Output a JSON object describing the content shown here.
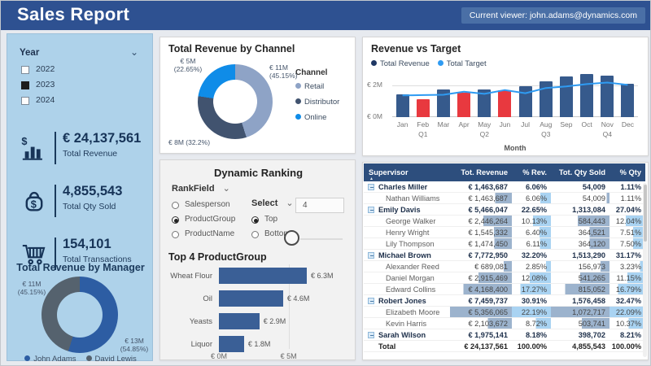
{
  "header": {
    "title": "Sales Report",
    "viewer_badge": "Current viewer: john.adams@dynamics.com"
  },
  "sidebar": {
    "year_filter": {
      "label": "Year",
      "options": [
        {
          "label": "2022",
          "checked": false
        },
        {
          "label": "2023",
          "checked": true
        },
        {
          "label": "2024",
          "checked": false
        }
      ]
    },
    "kpis": [
      {
        "icon": "revenue-chart-icon",
        "value": "€ 24,137,561",
        "label": "Total Revenue"
      },
      {
        "icon": "money-bag-icon",
        "value": "4,855,543",
        "label": "Total Qty Sold"
      },
      {
        "icon": "cart-icon",
        "value": "154,101",
        "label": "Total Transactions"
      }
    ],
    "manager_donut": {
      "title": "Total Revenue by Manager",
      "type": "donut",
      "slices": [
        {
          "name": "John Adams",
          "value": "€ 13M",
          "pct": 54.85,
          "color": "#2d5da3"
        },
        {
          "name": "David Lewis",
          "value": "€ 11M",
          "pct": 45.15,
          "color": "#55626e"
        }
      ],
      "labels": {
        "left1": "€ 11M",
        "left2": "(45.15%)",
        "right1": "€ 13M",
        "right2": "(54.85%)"
      }
    }
  },
  "channel_donut": {
    "title": "Total Revenue by Channel",
    "type": "donut",
    "legend_title": "Channel",
    "slices": [
      {
        "name": "Retail",
        "value": "€ 11M",
        "pct": 45.15,
        "color": "#8ea3c6"
      },
      {
        "name": "Distributor",
        "value": "€ 8M",
        "pct": 32.2,
        "color": "#41536f"
      },
      {
        "name": "Online",
        "value": "€ 5M",
        "pct": 22.65,
        "color": "#0f8ce8"
      }
    ],
    "labels": {
      "top_left1": "€ 5M",
      "top_left2": "(22.65%)",
      "top_right1": "€ 11M",
      "top_right2": "(45.15%)",
      "bottom": "€ 8M (32.2%)"
    }
  },
  "revenue_vs_target": {
    "title": "Revenue vs Target",
    "type": "bar+line",
    "legend": [
      {
        "label": "Total Revenue",
        "color": "#1f3864"
      },
      {
        "label": "Total Target",
        "color": "#2f9bf2"
      }
    ],
    "months": [
      "Jan",
      "Feb",
      "Mar",
      "Apr",
      "May",
      "Jun",
      "Jul",
      "Aug",
      "Sep",
      "Oct",
      "Nov",
      "Dec"
    ],
    "quarter_labels": [
      "",
      "Q1",
      "",
      "",
      "Q2",
      "",
      "",
      "Q3",
      "",
      "",
      "Q4",
      ""
    ],
    "revenue": [
      1.45,
      1.15,
      1.75,
      1.55,
      1.75,
      1.7,
      1.95,
      2.3,
      2.6,
      2.75,
      2.65,
      2.1
    ],
    "target": [
      1.38,
      1.4,
      1.42,
      1.62,
      1.48,
      1.72,
      1.52,
      1.85,
      1.95,
      2.1,
      2.2,
      2.05
    ],
    "ylim": [
      0,
      3
    ],
    "y_ticks": [
      "€ 0M",
      "€ 2M"
    ],
    "xlabel": "Month",
    "bar_color": "#365a8c",
    "below_target_color": "#e8393f",
    "line_color": "#2f9bf2"
  },
  "dynamic_ranking": {
    "title": "Dynamic Ranking",
    "rank_field_label": "RankField",
    "rank_options": [
      {
        "label": "Salesperson",
        "selected": false
      },
      {
        "label": "ProductGroup",
        "selected": true
      },
      {
        "label": "ProductName",
        "selected": false
      }
    ],
    "select_label": "Select",
    "select_options": [
      {
        "label": "Top",
        "selected": true
      },
      {
        "label": "Bottom",
        "selected": false
      }
    ],
    "count_value": "4"
  },
  "product_chart": {
    "title": "Top 4 ProductGroup",
    "type": "bar",
    "categories": [
      "Wheat Flour",
      "Oil",
      "Yeasts",
      "Liquor"
    ],
    "values": [
      6.3,
      4.6,
      2.9,
      1.8
    ],
    "value_labels": [
      "€ 6.3M",
      "€ 4.6M",
      "€ 2.9M",
      "€ 1.8M"
    ],
    "x_ticks": [
      "€ 0M",
      "€ 5M"
    ],
    "xlim": [
      0,
      7
    ],
    "bar_color": "#3a5f96"
  },
  "table": {
    "columns": [
      "Supervisor",
      "Tot. Revenue",
      "% Rev.",
      "Tot. Qty Sold",
      "% Qty"
    ],
    "bar_colors": {
      "revenue": "#9cb3cd",
      "rev_pct": "#a9d3f2",
      "qty": "#9cb3cd",
      "qty_pct": "#a9d3f2"
    },
    "rows": [
      {
        "level": "parent",
        "name": "Charles Miller",
        "revenue": "€ 1,463,687",
        "rev_pct": "6.06%",
        "qty": "54,009",
        "qty_pct": "1.11%"
      },
      {
        "level": "child",
        "name": "Nathan Williams",
        "revenue": "€ 1,463,687",
        "rev_pct": "6.06%",
        "qty": "54,009",
        "qty_pct": "1.11%"
      },
      {
        "level": "parent",
        "name": "Emily Davis",
        "revenue": "€ 5,466,047",
        "rev_pct": "22.65%",
        "qty": "1,313,084",
        "qty_pct": "27.04%"
      },
      {
        "level": "child",
        "name": "George Walker",
        "revenue": "€ 2,446,264",
        "rev_pct": "10.13%",
        "qty": "584,443",
        "qty_pct": "12.04%"
      },
      {
        "level": "child",
        "name": "Henry Wright",
        "revenue": "€ 1,545,332",
        "rev_pct": "6.40%",
        "qty": "364,521",
        "qty_pct": "7.51%"
      },
      {
        "level": "child",
        "name": "Lily Thompson",
        "revenue": "€ 1,474,450",
        "rev_pct": "6.11%",
        "qty": "364,120",
        "qty_pct": "7.50%"
      },
      {
        "level": "parent",
        "name": "Michael Brown",
        "revenue": "€ 7,772,950",
        "rev_pct": "32.20%",
        "qty": "1,513,290",
        "qty_pct": "31.17%"
      },
      {
        "level": "child",
        "name": "Alexander Reed",
        "revenue": "€ 689,081",
        "rev_pct": "2.85%",
        "qty": "156,973",
        "qty_pct": "3.23%"
      },
      {
        "level": "child",
        "name": "Daniel Morgan",
        "revenue": "€ 2,915,469",
        "rev_pct": "12.08%",
        "qty": "541,265",
        "qty_pct": "11.15%"
      },
      {
        "level": "child",
        "name": "Edward Collins",
        "revenue": "€ 4,168,400",
        "rev_pct": "17.27%",
        "qty": "815,052",
        "qty_pct": "16.79%"
      },
      {
        "level": "parent",
        "name": "Robert Jones",
        "revenue": "€ 7,459,737",
        "rev_pct": "30.91%",
        "qty": "1,576,458",
        "qty_pct": "32.47%"
      },
      {
        "level": "child",
        "name": "Elizabeth Moore",
        "revenue": "€ 5,356,065",
        "rev_pct": "22.19%",
        "qty": "1,072,717",
        "qty_pct": "22.09%"
      },
      {
        "level": "child",
        "name": "Kevin Harris",
        "revenue": "€ 2,103,672",
        "rev_pct": "8.72%",
        "qty": "503,741",
        "qty_pct": "10.37%"
      },
      {
        "level": "parent",
        "name": "Sarah Wilson",
        "revenue": "€ 1,975,141",
        "rev_pct": "8.18%",
        "qty": "398,702",
        "qty_pct": "8.21%"
      },
      {
        "level": "total",
        "name": "Total",
        "revenue": "€ 24,137,561",
        "rev_pct": "100.00%",
        "qty": "4,855,543",
        "qty_pct": "100.00%"
      }
    ]
  }
}
